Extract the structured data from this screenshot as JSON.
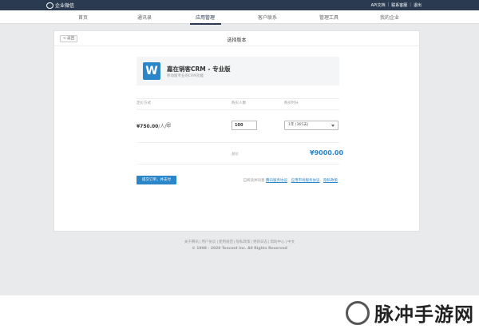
{
  "topbar": {
    "app_name": "企业微信",
    "links": [
      "API文档",
      "联系客服",
      "退出"
    ]
  },
  "nav": {
    "items": [
      "首页",
      "通讯录",
      "应用管理",
      "客户联系",
      "管理工具",
      "我的企业"
    ],
    "active": "应用管理"
  },
  "card": {
    "back_label": "< 返回",
    "title": "选择版本"
  },
  "product": {
    "icon_letter": "W",
    "name": "嘉在销客CRM - 专业版",
    "desc": "移动版专业的CRM功能"
  },
  "table": {
    "headers": [
      "定价方式",
      "购买人数",
      "购买时长"
    ],
    "price": "¥750.00",
    "price_unit": "/人/年",
    "quantity": "100",
    "period": "1年 (365天)",
    "total_label": "总价",
    "total_value": "¥9000.00"
  },
  "actions": {
    "submit_label": "提交订单，并支付",
    "agree_prefix": "已阅读并同意",
    "link1": "腾讯服务协议",
    "link2": "应用市场服务协议",
    "link3": "隐私政策"
  },
  "footer": {
    "links": [
      "关于腾讯",
      "用户协议",
      "使用规范",
      "隐私政策",
      "更新日志",
      "帮助中心",
      "中文"
    ],
    "copyright": "© 1998 - 2020 Tencent Inc. All Rights Reserved"
  },
  "watermark": {
    "text": "脉冲手游网"
  },
  "colors": {
    "topbar": "#2a3a50",
    "accent": "#2a86c8",
    "page_bg": "#e9eaec"
  }
}
